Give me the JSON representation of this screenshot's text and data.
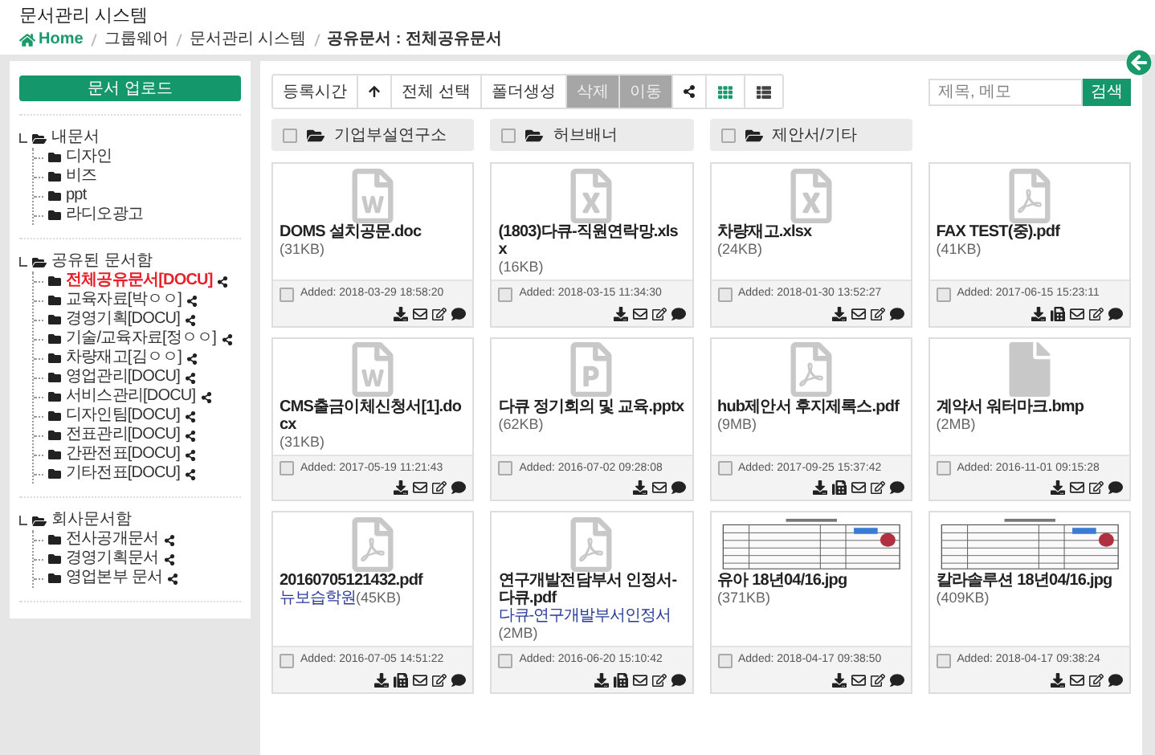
{
  "header": {
    "title": "문서관리 시스템",
    "breadcrumb": [
      "Home",
      "그룹웨어",
      "문서관리 시스템",
      "공유문서 : 전체공유문서"
    ]
  },
  "sidebar": {
    "upload_button": "문서 업로드",
    "tree": [
      {
        "label": "내문서",
        "children": [
          {
            "label": "디자인",
            "shared": false,
            "selected": false
          },
          {
            "label": "비즈",
            "shared": false,
            "selected": false
          },
          {
            "label": "ppt",
            "shared": false,
            "selected": false
          },
          {
            "label": "라디오광고",
            "shared": false,
            "selected": false
          }
        ]
      },
      {
        "label": "공유된 문서함",
        "children": [
          {
            "label": "전체공유문서[DOCU]",
            "shared": true,
            "selected": true
          },
          {
            "label": "교육자료[박ㅇㅇ]",
            "shared": true,
            "selected": false
          },
          {
            "label": "경영기획[DOCU]",
            "shared": true,
            "selected": false
          },
          {
            "label": "기술/교육자료[정ㅇㅇ]",
            "shared": true,
            "selected": false
          },
          {
            "label": "차량재고[김ㅇㅇ]",
            "shared": true,
            "selected": false
          },
          {
            "label": "영업관리[DOCU]",
            "shared": true,
            "selected": false
          },
          {
            "label": "서비스관리[DOCU]",
            "shared": true,
            "selected": false
          },
          {
            "label": "디자인팀[DOCU]",
            "shared": true,
            "selected": false
          },
          {
            "label": "전표관리[DOCU]",
            "shared": true,
            "selected": false
          },
          {
            "label": "간판전표[DOCU]",
            "shared": true,
            "selected": false
          },
          {
            "label": "기타전표[DOCU]",
            "shared": true,
            "selected": false
          }
        ]
      },
      {
        "label": "회사문서함",
        "children": [
          {
            "label": "전사공개문서",
            "shared": true,
            "selected": false
          },
          {
            "label": "경영기획문서",
            "shared": true,
            "selected": false
          },
          {
            "label": "영업본부 문서",
            "shared": true,
            "selected": false
          }
        ]
      }
    ]
  },
  "toolbar": [
    {
      "kind": "text",
      "label": "등록시간",
      "disabled": false
    },
    {
      "kind": "up"
    },
    {
      "kind": "text",
      "label": "전체 선택",
      "disabled": false
    },
    {
      "kind": "text",
      "label": "폴더생성",
      "disabled": false
    },
    {
      "kind": "text",
      "label": "삭제",
      "disabled": true
    },
    {
      "kind": "text",
      "label": "이동",
      "disabled": true
    },
    {
      "kind": "share"
    }
  ],
  "views": [
    {
      "kind": "grid",
      "selected": true
    },
    {
      "kind": "list",
      "selected": false
    }
  ],
  "search": {
    "placeholder": "제목, 메모",
    "button": "검색"
  },
  "folders": [
    {
      "name": "기업부설연구소",
      "checked": false
    },
    {
      "name": "허브배너",
      "checked": false
    },
    {
      "name": "제안서/기타",
      "checked": false
    }
  ],
  "files": [
    {
      "kind": "word",
      "name": "DOMS 설치공문.doc",
      "size": "(31KB)",
      "added": "Added: 2018-03-29 18:58:20",
      "checked": false,
      "fax": false,
      "edit": true
    },
    {
      "kind": "excel",
      "name": "(1803)다큐-직원연락망.xlsx",
      "size": "(16KB)",
      "added": "Added: 2018-03-15 11:34:30",
      "checked": false,
      "fax": false,
      "edit": true
    },
    {
      "kind": "excel",
      "name": "차량재고.xlsx",
      "size": "(24KB)",
      "added": "Added: 2018-01-30 13:52:27",
      "checked": false,
      "fax": false,
      "edit": true
    },
    {
      "kind": "pdf",
      "name": "FAX TEST(중).pdf",
      "size": "(41KB)",
      "added": "Added: 2017-06-15 15:23:11",
      "checked": false,
      "fax": true,
      "edit": true
    },
    {
      "kind": "word",
      "name": "CMS출금이체신청서[1].docx",
      "size": "(31KB)",
      "added": "Added: 2017-05-19 11:21:43",
      "checked": false,
      "fax": false,
      "edit": true
    },
    {
      "kind": "ppt",
      "name": "다큐 정기회의 및 교육.pptx",
      "size": "(62KB)",
      "added": "Added: 2016-07-02 09:28:08",
      "checked": false,
      "fax": false,
      "edit": false
    },
    {
      "kind": "pdf",
      "name": "hub제안서 후지제록스.pdf",
      "size": "(9MB)",
      "added": "Added: 2017-09-25 15:37:42",
      "checked": false,
      "fax": true,
      "edit": true
    },
    {
      "kind": "blank",
      "name": "계약서 워터마크.bmp",
      "size": "(2MB)",
      "added": "Added: 2016-11-01 09:15:28",
      "checked": false,
      "fax": false,
      "edit": true
    },
    {
      "kind": "pdf",
      "name": "20160705121432.pdf",
      "owner": "뉴보습학원",
      "size": "(45KB)",
      "added": "Added: 2016-07-05 14:51:22",
      "checked": false,
      "fax": true,
      "edit": true
    },
    {
      "kind": "pdf",
      "name": "연구개발전담부서 인정서-다큐.pdf",
      "owner": "다큐-연구개발부서인정서",
      "size": "(2MB)",
      "added": "Added: 2016-06-20 15:10:42",
      "checked": false,
      "fax": true,
      "edit": true
    },
    {
      "kind": "picture",
      "name": "유아 18년04/16.jpg",
      "size": "(371KB)",
      "added": "Added: 2018-04-17 09:38:50",
      "checked": false,
      "fax": false,
      "edit": true
    },
    {
      "kind": "picture",
      "name": "칼라솔루션 18년04/16.jpg",
      "size": "(409KB)",
      "added": "Added: 2018-04-17 09:38:24",
      "checked": false,
      "fax": false,
      "edit": true
    }
  ]
}
